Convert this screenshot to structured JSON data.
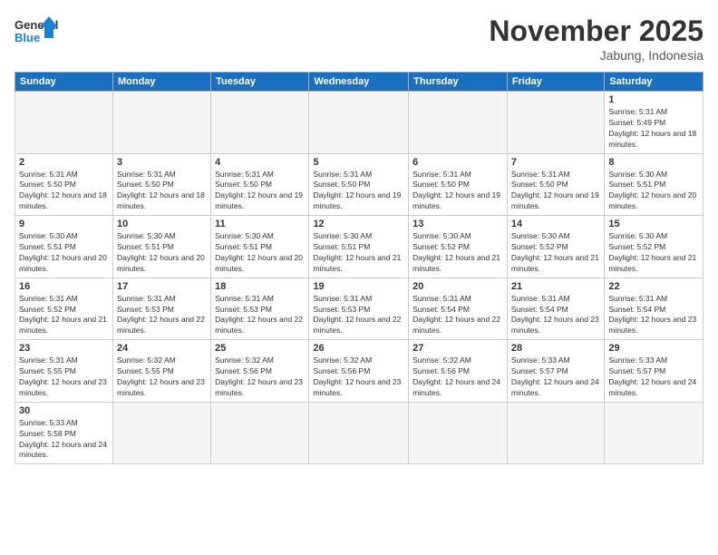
{
  "logo": {
    "text_general": "General",
    "text_blue": "Blue"
  },
  "header": {
    "month": "November 2025",
    "location": "Jabung, Indonesia"
  },
  "days_of_week": [
    "Sunday",
    "Monday",
    "Tuesday",
    "Wednesday",
    "Thursday",
    "Friday",
    "Saturday"
  ],
  "weeks": [
    [
      {
        "day": "",
        "empty": true
      },
      {
        "day": "",
        "empty": true
      },
      {
        "day": "",
        "empty": true
      },
      {
        "day": "",
        "empty": true
      },
      {
        "day": "",
        "empty": true
      },
      {
        "day": "",
        "empty": true
      },
      {
        "day": "1",
        "sunrise": "5:31 AM",
        "sunset": "5:49 PM",
        "daylight": "12 hours and 18 minutes."
      }
    ],
    [
      {
        "day": "2",
        "sunrise": "5:31 AM",
        "sunset": "5:50 PM",
        "daylight": "12 hours and 18 minutes."
      },
      {
        "day": "3",
        "sunrise": "5:31 AM",
        "sunset": "5:50 PM",
        "daylight": "12 hours and 18 minutes."
      },
      {
        "day": "4",
        "sunrise": "5:31 AM",
        "sunset": "5:50 PM",
        "daylight": "12 hours and 19 minutes."
      },
      {
        "day": "5",
        "sunrise": "5:31 AM",
        "sunset": "5:50 PM",
        "daylight": "12 hours and 19 minutes."
      },
      {
        "day": "6",
        "sunrise": "5:31 AM",
        "sunset": "5:50 PM",
        "daylight": "12 hours and 19 minutes."
      },
      {
        "day": "7",
        "sunrise": "5:31 AM",
        "sunset": "5:50 PM",
        "daylight": "12 hours and 19 minutes."
      },
      {
        "day": "8",
        "sunrise": "5:30 AM",
        "sunset": "5:51 PM",
        "daylight": "12 hours and 20 minutes."
      }
    ],
    [
      {
        "day": "9",
        "sunrise": "5:30 AM",
        "sunset": "5:51 PM",
        "daylight": "12 hours and 20 minutes."
      },
      {
        "day": "10",
        "sunrise": "5:30 AM",
        "sunset": "5:51 PM",
        "daylight": "12 hours and 20 minutes."
      },
      {
        "day": "11",
        "sunrise": "5:30 AM",
        "sunset": "5:51 PM",
        "daylight": "12 hours and 20 minutes."
      },
      {
        "day": "12",
        "sunrise": "5:30 AM",
        "sunset": "5:51 PM",
        "daylight": "12 hours and 21 minutes."
      },
      {
        "day": "13",
        "sunrise": "5:30 AM",
        "sunset": "5:52 PM",
        "daylight": "12 hours and 21 minutes."
      },
      {
        "day": "14",
        "sunrise": "5:30 AM",
        "sunset": "5:52 PM",
        "daylight": "12 hours and 21 minutes."
      },
      {
        "day": "15",
        "sunrise": "5:30 AM",
        "sunset": "5:52 PM",
        "daylight": "12 hours and 21 minutes."
      }
    ],
    [
      {
        "day": "16",
        "sunrise": "5:31 AM",
        "sunset": "5:52 PM",
        "daylight": "12 hours and 21 minutes."
      },
      {
        "day": "17",
        "sunrise": "5:31 AM",
        "sunset": "5:53 PM",
        "daylight": "12 hours and 22 minutes."
      },
      {
        "day": "18",
        "sunrise": "5:31 AM",
        "sunset": "5:53 PM",
        "daylight": "12 hours and 22 minutes."
      },
      {
        "day": "19",
        "sunrise": "5:31 AM",
        "sunset": "5:53 PM",
        "daylight": "12 hours and 22 minutes."
      },
      {
        "day": "20",
        "sunrise": "5:31 AM",
        "sunset": "5:54 PM",
        "daylight": "12 hours and 22 minutes."
      },
      {
        "day": "21",
        "sunrise": "5:31 AM",
        "sunset": "5:54 PM",
        "daylight": "12 hours and 23 minutes."
      },
      {
        "day": "22",
        "sunrise": "5:31 AM",
        "sunset": "5:54 PM",
        "daylight": "12 hours and 23 minutes."
      }
    ],
    [
      {
        "day": "23",
        "sunrise": "5:31 AM",
        "sunset": "5:55 PM",
        "daylight": "12 hours and 23 minutes."
      },
      {
        "day": "24",
        "sunrise": "5:32 AM",
        "sunset": "5:55 PM",
        "daylight": "12 hours and 23 minutes."
      },
      {
        "day": "25",
        "sunrise": "5:32 AM",
        "sunset": "5:56 PM",
        "daylight": "12 hours and 23 minutes."
      },
      {
        "day": "26",
        "sunrise": "5:32 AM",
        "sunset": "5:56 PM",
        "daylight": "12 hours and 23 minutes."
      },
      {
        "day": "27",
        "sunrise": "5:32 AM",
        "sunset": "5:56 PM",
        "daylight": "12 hours and 24 minutes."
      },
      {
        "day": "28",
        "sunrise": "5:33 AM",
        "sunset": "5:57 PM",
        "daylight": "12 hours and 24 minutes."
      },
      {
        "day": "29",
        "sunrise": "5:33 AM",
        "sunset": "5:57 PM",
        "daylight": "12 hours and 24 minutes."
      }
    ],
    [
      {
        "day": "30",
        "sunrise": "5:33 AM",
        "sunset": "5:58 PM",
        "daylight": "12 hours and 24 minutes."
      },
      {
        "day": "",
        "empty": true
      },
      {
        "day": "",
        "empty": true
      },
      {
        "day": "",
        "empty": true
      },
      {
        "day": "",
        "empty": true
      },
      {
        "day": "",
        "empty": true
      },
      {
        "day": "",
        "empty": true
      }
    ]
  ],
  "labels": {
    "sunrise": "Sunrise:",
    "sunset": "Sunset:",
    "daylight": "Daylight:"
  }
}
